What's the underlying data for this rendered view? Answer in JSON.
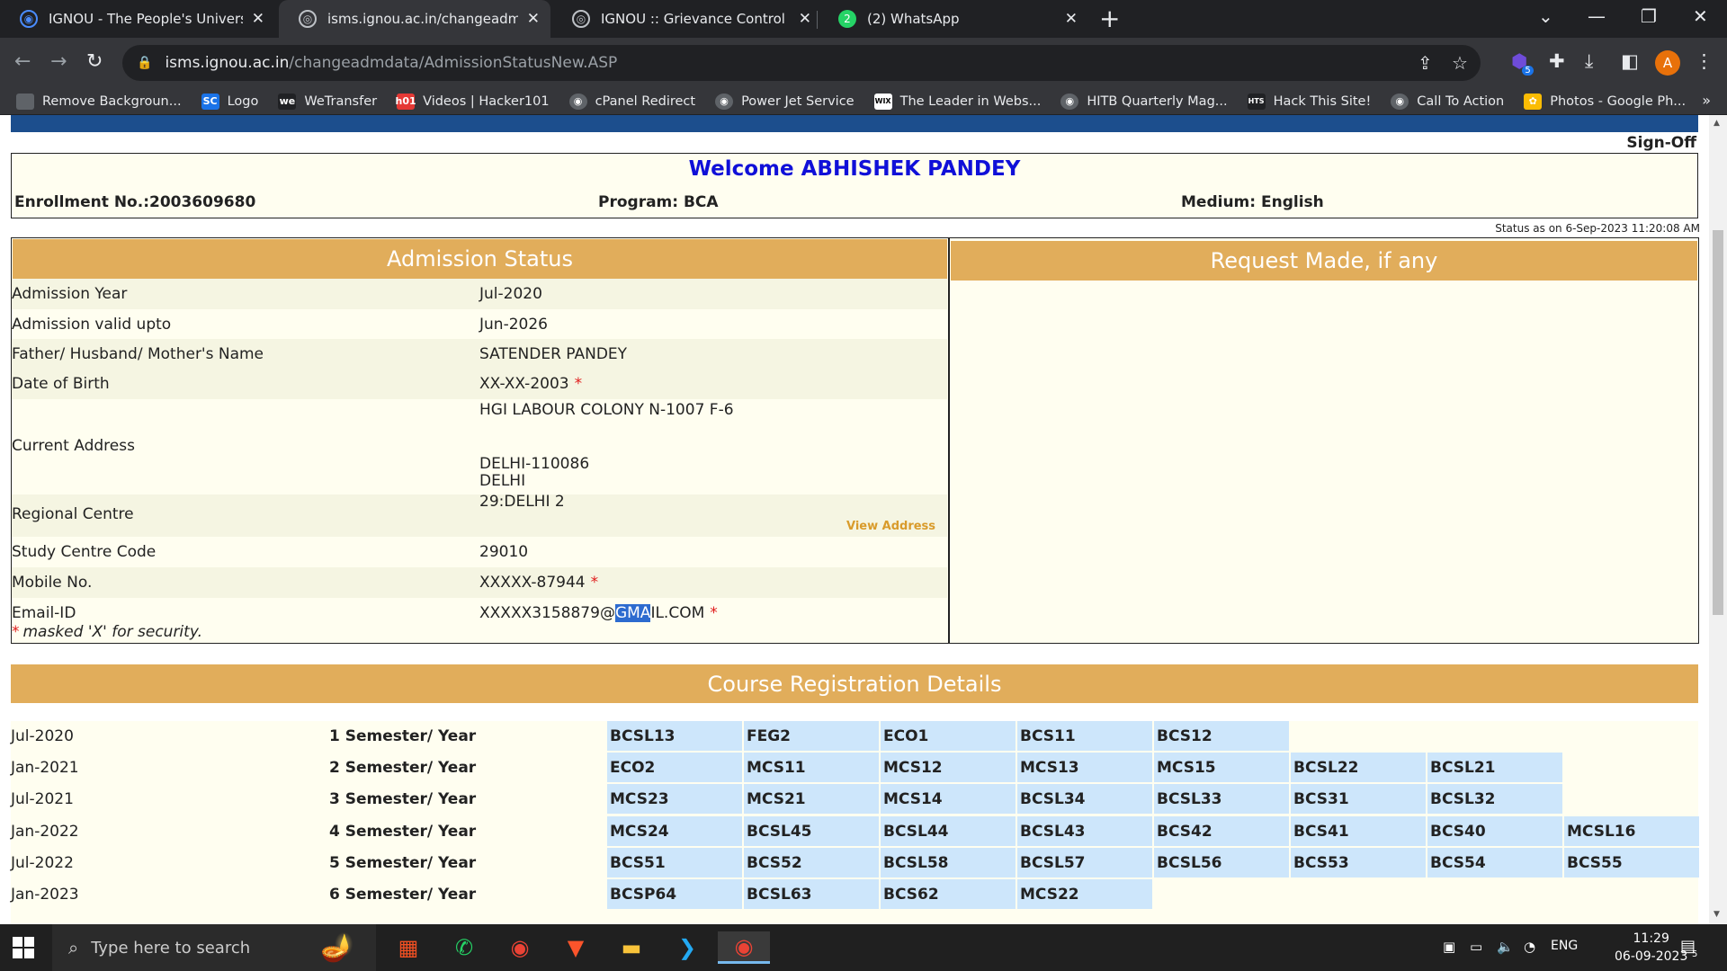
{
  "browser": {
    "tabs": [
      {
        "title": "IGNOU - The People's University",
        "icon": "ignou-favicon",
        "active": false
      },
      {
        "title": "isms.ignou.ac.in/changeadmdata",
        "icon": "globe-icon",
        "active": true
      },
      {
        "title": "IGNOU :: Grievance Control Room",
        "icon": "globe-icon",
        "active": false
      },
      {
        "title": "(2) WhatsApp",
        "icon": "whatsapp-favicon",
        "badge": "2",
        "active": false
      }
    ],
    "new_tab": "+",
    "url_host": "isms.ignou.ac.in",
    "url_path": "/changeadmdata/AdmissionStatusNew.ASP",
    "profile_initial": "A",
    "extension_badge": "5",
    "bookmarks": [
      {
        "label": "Remove Backgroun...",
        "icon_color": "#5f6368",
        "icon_text": "◆"
      },
      {
        "label": "Logo",
        "icon_color": "#1a73e8",
        "icon_text": "SC"
      },
      {
        "label": "WeTransfer",
        "icon_color": "#202124",
        "icon_text": "we"
      },
      {
        "label": "Videos | Hacker101",
        "icon_color": "#e53935",
        "icon_text": "h01"
      },
      {
        "label": "cPanel Redirect",
        "icon_color": "#5f6368",
        "icon_text": "◉"
      },
      {
        "label": "Power Jet Service",
        "icon_color": "#5f6368",
        "icon_text": "◉"
      },
      {
        "label": "The Leader in Webs...",
        "icon_color": "#ffffff",
        "icon_text": "WIX"
      },
      {
        "label": "HITB Quarterly Mag...",
        "icon_color": "#5f6368",
        "icon_text": "◉"
      },
      {
        "label": "Hack This Site!",
        "icon_color": "#202124",
        "icon_text": "HTS"
      },
      {
        "label": "Call To Action",
        "icon_color": "#5f6368",
        "icon_text": "◉"
      },
      {
        "label": "Photos - Google Ph...",
        "icon_color": "#fbbc04",
        "icon_text": "✿"
      }
    ],
    "bookmarks_more": "»"
  },
  "page": {
    "sign_off": "Sign-Off",
    "welcome": "Welcome ABHISHEK PANDEY",
    "enrollment": "Enrollment No.:2003609680",
    "program": "Program: BCA",
    "medium": "Medium: English",
    "status_as_on": "Status as on 6-Sep-2023 11:20:08 AM",
    "admission_title": "Admission Status",
    "request_title": "Request Made, if any",
    "admission": {
      "year_label": "Admission Year",
      "year_value": "Jul-2020",
      "valid_label": "Admission valid upto",
      "valid_value": "Jun-2026",
      "parent_label": "Father/ Husband/ Mother's Name",
      "parent_value": "SATENDER PANDEY",
      "dob_label": "Date of Birth",
      "dob_value": "XX-XX-2003",
      "address_label": "Current Address",
      "address_line1": "HGI LABOUR COLONY N-1007 F-6",
      "address_line2": "DELHI-110086",
      "address_line3": "DELHI",
      "rc_label": "Regional Centre",
      "rc_value": "29:DELHI 2",
      "view_address": "View Address",
      "sc_label": "Study Centre Code",
      "sc_value": "29010",
      "mobile_label": "Mobile No.",
      "mobile_value": "XXXXX-87944",
      "email_label": "Email-ID",
      "email_pre": "XXXXX3158879@",
      "email_sel": "GMA",
      "email_post": "IL.COM",
      "star": "*",
      "masked_note": "masked 'X' for security."
    },
    "course_title": "Course Registration Details",
    "courses": [
      {
        "session": "Jul-2020",
        "semester": "1 Semester/ Year",
        "codes": [
          "BCSL13",
          "FEG2",
          "ECO1",
          "BCS11",
          "BCS12"
        ]
      },
      {
        "session": "Jan-2021",
        "semester": "2 Semester/ Year",
        "codes": [
          "ECO2",
          "MCS11",
          "MCS12",
          "MCS13",
          "MCS15",
          "BCSL22",
          "BCSL21"
        ]
      },
      {
        "session": "Jul-2021",
        "semester": "3 Semester/ Year",
        "codes": [
          "MCS23",
          "MCS21",
          "MCS14",
          "BCSL34",
          "BCSL33",
          "BCS31",
          "BCSL32"
        ]
      },
      {
        "session": "Jan-2022",
        "semester": "4 Semester/ Year",
        "codes": [
          "MCS24",
          "BCSL45",
          "BCSL44",
          "BCSL43",
          "BCS42",
          "BCS41",
          "BCS40",
          "MCSL16"
        ]
      },
      {
        "session": "Jul-2022",
        "semester": "5 Semester/ Year",
        "codes": [
          "BCS51",
          "BCS52",
          "BCSL58",
          "BCSL57",
          "BCSL56",
          "BCS53",
          "BCS54",
          "BCS55"
        ]
      },
      {
        "session": "Jan-2023",
        "semester": "6 Semester/ Year",
        "codes": [
          "BCSP64",
          "BCSL63",
          "BCS62",
          "MCS22"
        ]
      }
    ]
  },
  "taskbar": {
    "search_placeholder": "Type here to search",
    "language": "ENG",
    "time": "11:29",
    "date": "06-09-2023",
    "notifications": "5"
  }
}
